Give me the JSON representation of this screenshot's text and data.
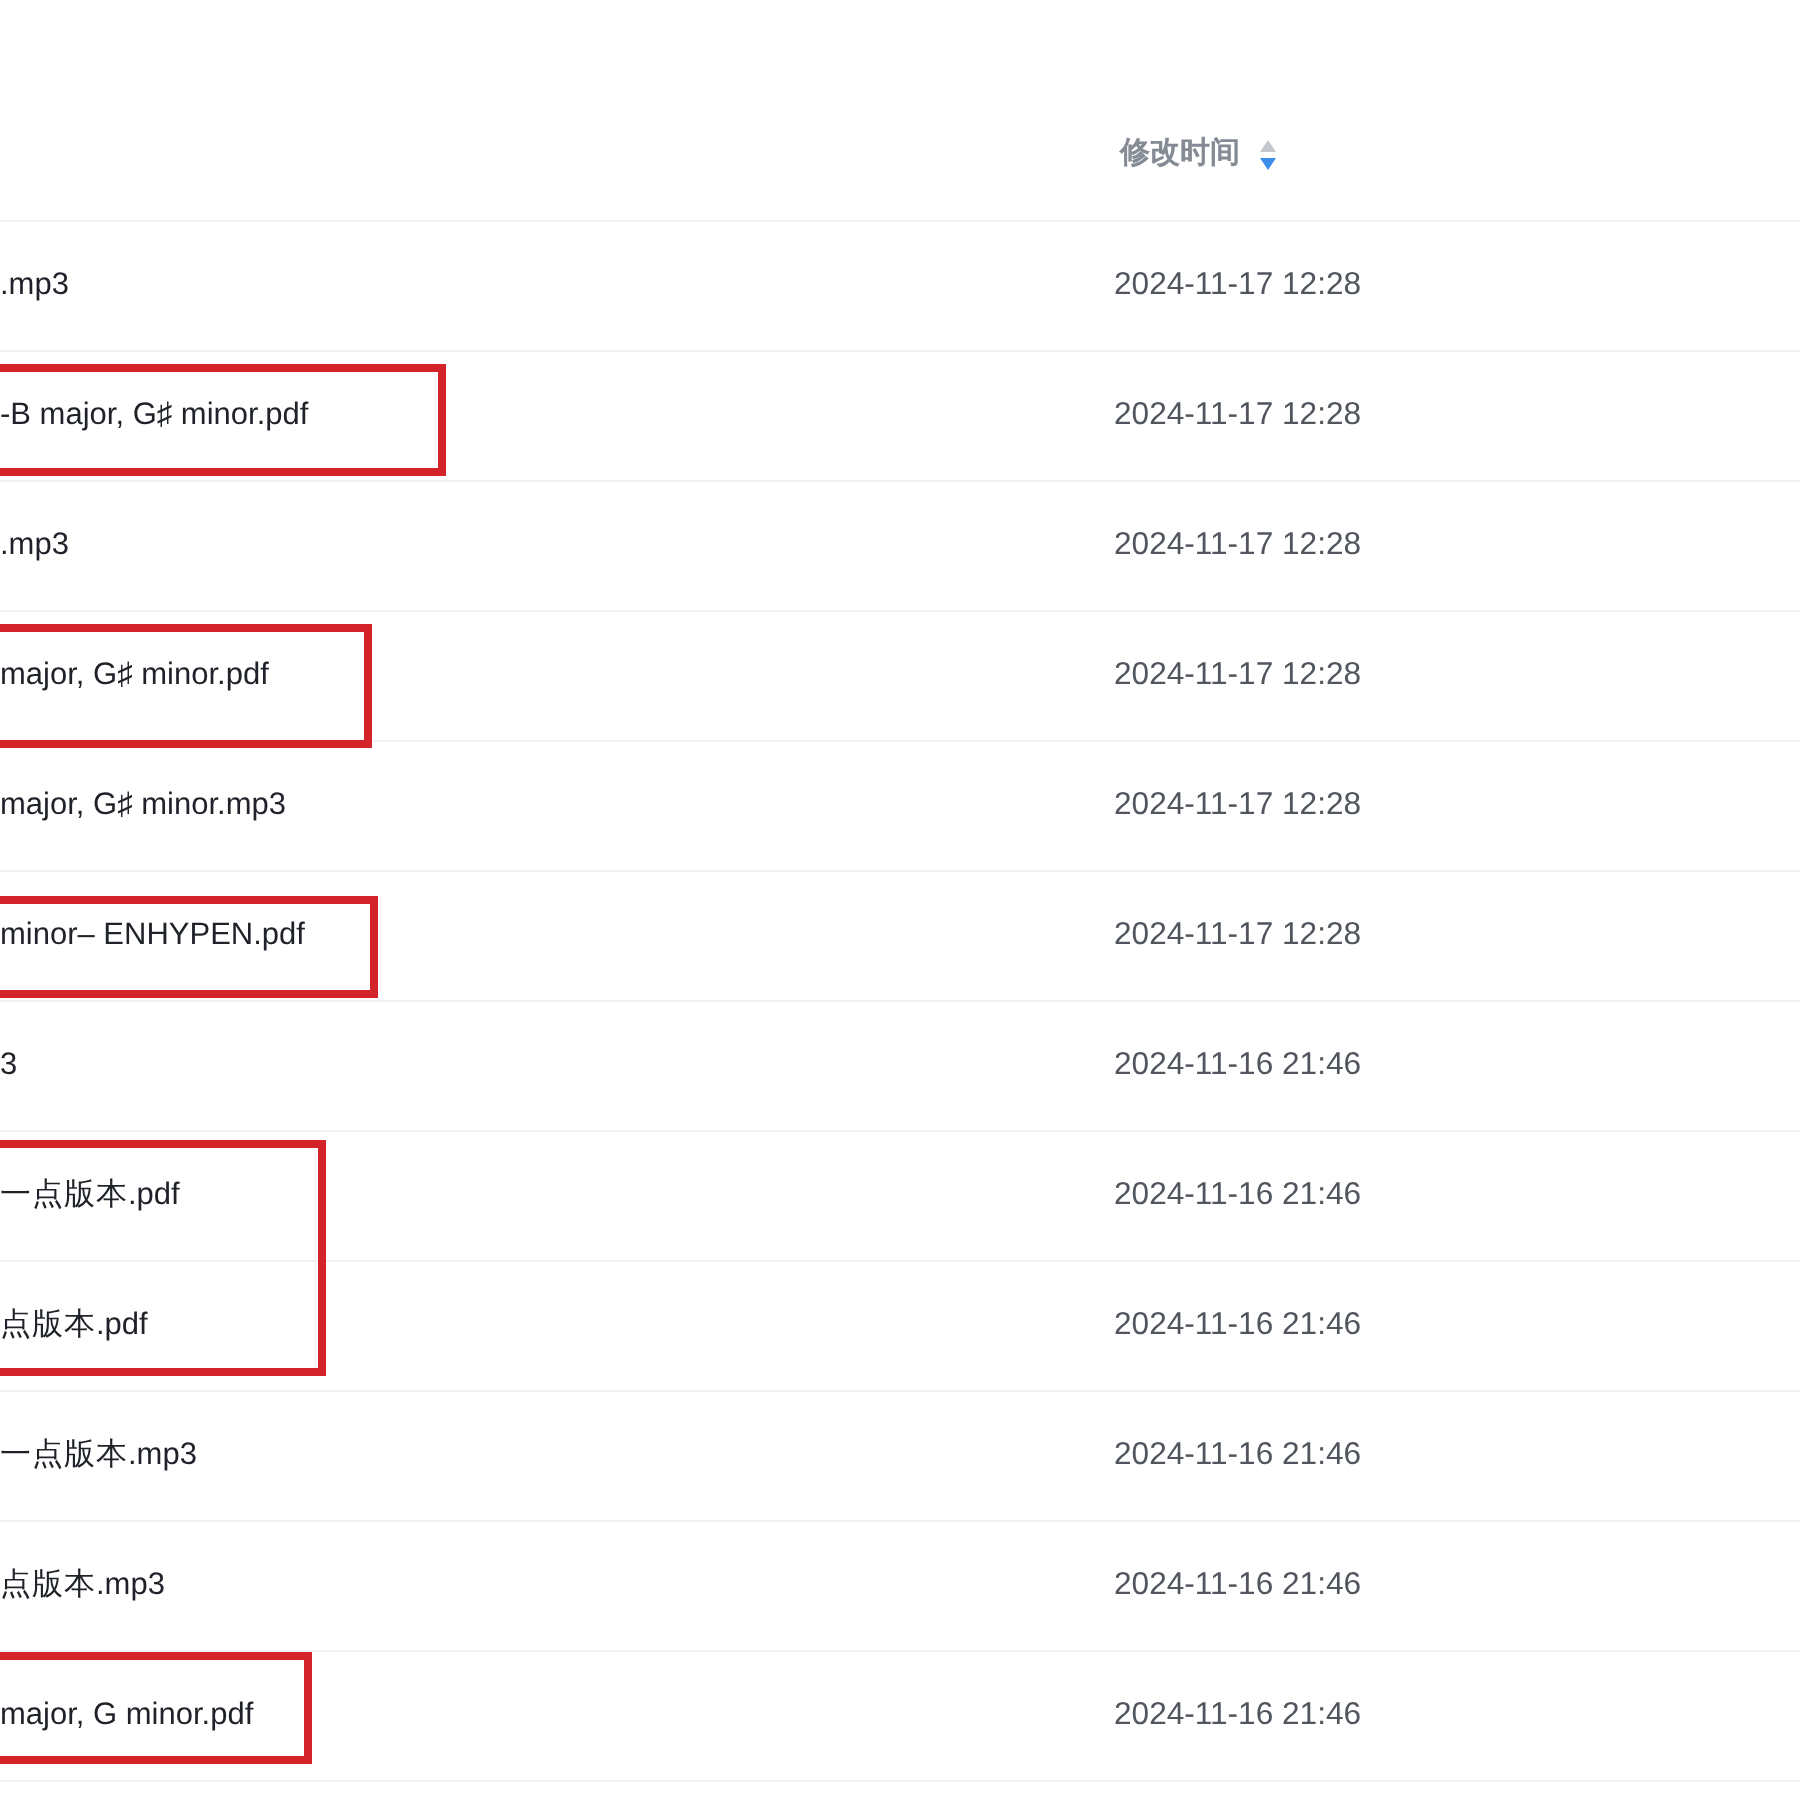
{
  "header": {
    "label": "修改时间",
    "descending": true
  },
  "rows": [
    {
      "name": ".mp3",
      "modified": "2024-11-17 12:28",
      "boxed": false
    },
    {
      "name": "-B major, G♯ minor.pdf",
      "modified": "2024-11-17 12:28",
      "boxed": true
    },
    {
      "name": ".mp3",
      "modified": "2024-11-17 12:28",
      "boxed": false
    },
    {
      "name": "major, G♯ minor.pdf",
      "modified": "2024-11-17 12:28",
      "boxed": true
    },
    {
      "name": "major, G♯ minor.mp3",
      "modified": "2024-11-17 12:28",
      "boxed": false
    },
    {
      "name": "minor– ENHYPEN.pdf",
      "modified": "2024-11-17 12:28",
      "boxed": true
    },
    {
      "name": "3",
      "modified": "2024-11-16 21:46",
      "boxed": false
    },
    {
      "name": "一点版本.pdf",
      "modified": "2024-11-16 21:46",
      "boxed": true
    },
    {
      "name": "点版本.pdf",
      "modified": "2024-11-16 21:46",
      "boxed": true
    },
    {
      "name": "一点版本.mp3",
      "modified": "2024-11-16 21:46",
      "boxed": false
    },
    {
      "name": "点版本.mp3",
      "modified": "2024-11-16 21:46",
      "boxed": false
    },
    {
      "name": "major, G minor.pdf",
      "modified": "2024-11-16 21:46",
      "boxed": true
    }
  ]
}
